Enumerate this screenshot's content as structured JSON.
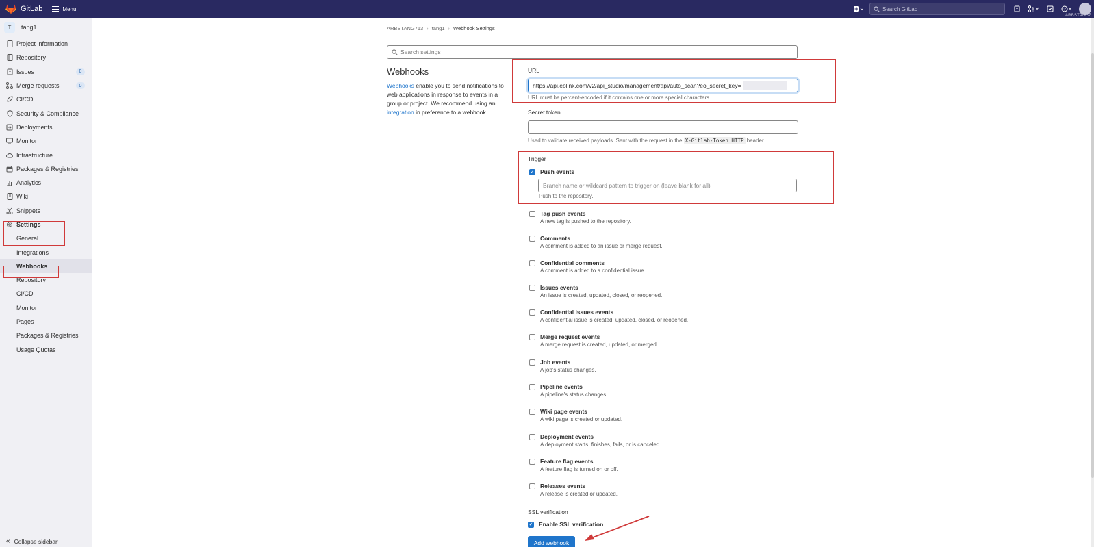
{
  "topbar": {
    "brand": "GitLab",
    "menu_label": "Menu",
    "search_placeholder": "Search GitLab",
    "user_label": "ARBSTANGZ"
  },
  "sidebar": {
    "project_initial": "T",
    "project_name": "tang1",
    "items": [
      {
        "label": "Project information",
        "icon": "info-icon"
      },
      {
        "label": "Repository",
        "icon": "book-icon"
      },
      {
        "label": "Issues",
        "icon": "issues-icon",
        "badge": "0"
      },
      {
        "label": "Merge requests",
        "icon": "merge-icon",
        "badge": "0"
      },
      {
        "label": "CI/CD",
        "icon": "rocket-icon"
      },
      {
        "label": "Security & Compliance",
        "icon": "shield-icon"
      },
      {
        "label": "Deployments",
        "icon": "deploy-icon"
      },
      {
        "label": "Monitor",
        "icon": "monitor-icon"
      },
      {
        "label": "Infrastructure",
        "icon": "cloud-icon"
      },
      {
        "label": "Packages & Registries",
        "icon": "package-icon"
      },
      {
        "label": "Analytics",
        "icon": "chart-icon"
      },
      {
        "label": "Wiki",
        "icon": "wiki-icon"
      },
      {
        "label": "Snippets",
        "icon": "snippet-icon"
      },
      {
        "label": "Settings",
        "icon": "gear-icon"
      }
    ],
    "settings_sub": [
      "General",
      "Integrations",
      "Webhooks",
      "Repository",
      "CI/CD",
      "Monitor",
      "Pages",
      "Packages & Registries",
      "Usage Quotas"
    ],
    "active_sub": "Webhooks",
    "collapse_label": "Collapse sidebar"
  },
  "breadcrumb": [
    "ARBSTANG713",
    "tang1",
    "Webhook Settings"
  ],
  "search_settings_placeholder": "Search settings",
  "webhooks": {
    "title": "Webhooks",
    "desc_link1": "Webhooks",
    "desc_part1": " enable you to send notifications to web applications in response to events in a group or project. We recommend using an ",
    "desc_link2": "integration",
    "desc_part2": " in preference to a webhook."
  },
  "form": {
    "url_label": "URL",
    "url_value": "https://api.eolink.com/v2/api_studio/management/api/auto_scan?eo_secret_key=",
    "url_help": "URL must be percent-encoded if it contains one or more special characters.",
    "secret_label": "Secret token",
    "secret_help_pre": "Used to validate received payloads. Sent with the request in the ",
    "secret_help_code": "X-Gitlab-Token HTTP",
    "secret_help_post": " header.",
    "trigger_label": "Trigger",
    "push_title": "Push events",
    "push_placeholder": "Branch name or wildcard pattern to trigger on (leave blank for all)",
    "push_desc": "Push to the repository.",
    "events": [
      {
        "title": "Tag push events",
        "desc": "A new tag is pushed to the repository."
      },
      {
        "title": "Comments",
        "desc": "A comment is added to an issue or merge request."
      },
      {
        "title": "Confidential comments",
        "desc": "A comment is added to a confidential issue."
      },
      {
        "title": "Issues events",
        "desc": "An issue is created, updated, closed, or reopened."
      },
      {
        "title": "Confidential issues events",
        "desc": "A confidential issue is created, updated, closed, or reopened."
      },
      {
        "title": "Merge request events",
        "desc": "A merge request is created, updated, or merged."
      },
      {
        "title": "Job events",
        "desc": "A job's status changes."
      },
      {
        "title": "Pipeline events",
        "desc": "A pipeline's status changes."
      },
      {
        "title": "Wiki page events",
        "desc": "A wiki page is created or updated."
      },
      {
        "title": "Deployment events",
        "desc": "A deployment starts, finishes, fails, or is canceled."
      },
      {
        "title": "Feature flag events",
        "desc": "A feature flag is turned on or off."
      },
      {
        "title": "Releases events",
        "desc": "A release is created or updated."
      }
    ],
    "ssl_label": "SSL verification",
    "ssl_checkbox": "Enable SSL verification",
    "submit": "Add webhook"
  },
  "colors": {
    "topbar": "#292961",
    "accent": "#1f75cb",
    "highlight": "#d03a3a"
  }
}
